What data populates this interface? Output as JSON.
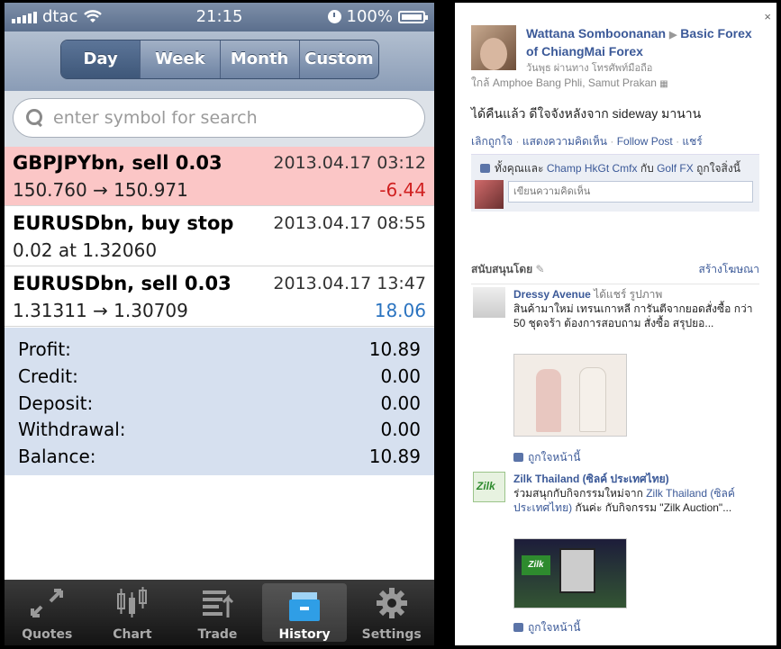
{
  "status_bar": {
    "carrier": "dtac",
    "time": "21:15",
    "battery": "100%"
  },
  "segments": [
    {
      "label": "Day",
      "selected": true
    },
    {
      "label": "Week",
      "selected": false
    },
    {
      "label": "Month",
      "selected": false
    },
    {
      "label": "Custom",
      "selected": false
    }
  ],
  "search": {
    "placeholder": "enter symbol for search"
  },
  "orders": [
    {
      "title": "GBPJPYbn, sell 0.03",
      "datetime": "2013.04.17 03:12",
      "prices": "150.760 → 150.971",
      "profit": "-6.44",
      "highlight": "#fbc6c6",
      "profit_color": "#d02020"
    },
    {
      "title": "EURUSDbn, buy stop",
      "datetime": "2013.04.17 08:55",
      "prices": "0.02 at 1.32060",
      "profit": "",
      "highlight": "#ffffff",
      "profit_color": "#333333"
    },
    {
      "title": "EURUSDbn, sell 0.03",
      "datetime": "2013.04.17 13:47",
      "prices": "1.31311 → 1.30709",
      "profit": "18.06",
      "highlight": "#ffffff",
      "profit_color": "#2a73c0"
    }
  ],
  "summary": [
    {
      "label": "Profit:",
      "value": "10.89"
    },
    {
      "label": "Credit:",
      "value": "0.00"
    },
    {
      "label": "Deposit:",
      "value": "0.00"
    },
    {
      "label": "Withdrawal:",
      "value": "0.00"
    },
    {
      "label": "Balance:",
      "value": "10.89"
    }
  ],
  "tabs": [
    {
      "label": "Quotes",
      "icon": "quotes-icon",
      "selected": false
    },
    {
      "label": "Chart",
      "icon": "chart-icon",
      "selected": false
    },
    {
      "label": "Trade",
      "icon": "trade-icon",
      "selected": false
    },
    {
      "label": "History",
      "icon": "history-icon",
      "selected": true
    },
    {
      "label": "Settings",
      "icon": "settings-icon",
      "selected": false
    }
  ],
  "facebook": {
    "close": "×",
    "author": "Wattana Somboonanan",
    "target": "Basic Forex of ChiangMai Forex",
    "meta": "วันพุธ ผ่านทาง โทรศัพท์มือถือ",
    "location": "ใกล้ Amphoe Bang Phli, Samut Prakan",
    "post": "ได้คืนแล้ว ดีใจจังหลังจาก sideway มานาน",
    "actions": [
      "เลิกถูกใจ",
      "แสดงความคิดเห็น",
      "Follow Post",
      "แชร์"
    ],
    "likes_prefix": "ทั้งคุณและ",
    "likes_person1": "Champ HkGt Cmfx",
    "likes_mid": "กับ",
    "likes_person2": "Golf FX",
    "likes_suffix": "ถูกใจสิ่งนี้",
    "comment_placeholder": "เขียนความคิดเห็น",
    "sponsored": "สนับสนุนโดย",
    "create_ad": "สร้างโฆษณา",
    "ads": [
      {
        "name": "Dressy Avenue",
        "source": "ได้แชร์ รูปภาพ",
        "text": "สินค้ามาใหม่ เทรนเกาหลี การันตีจากยอดสั่งซื้อ กว่า 50 ชุดจร้า ต้องการสอบถาม สั่งซื้อ สรุปยอ...",
        "like": "ถูกใจหน้านี้"
      },
      {
        "name": "Zilk Thailand (ซิลค์ ประเทศไทย)",
        "text_prefix": "ร่วมสนุกกับกิจกรรมใหม่จาก",
        "text_link": "Zilk Thailand (ซิลค์ ประเทศไทย)",
        "text_suffix": "กันค่ะ กับกิจกรรม \"Zilk Auction\"...",
        "like": "ถูกใจหน้านี้"
      }
    ]
  }
}
